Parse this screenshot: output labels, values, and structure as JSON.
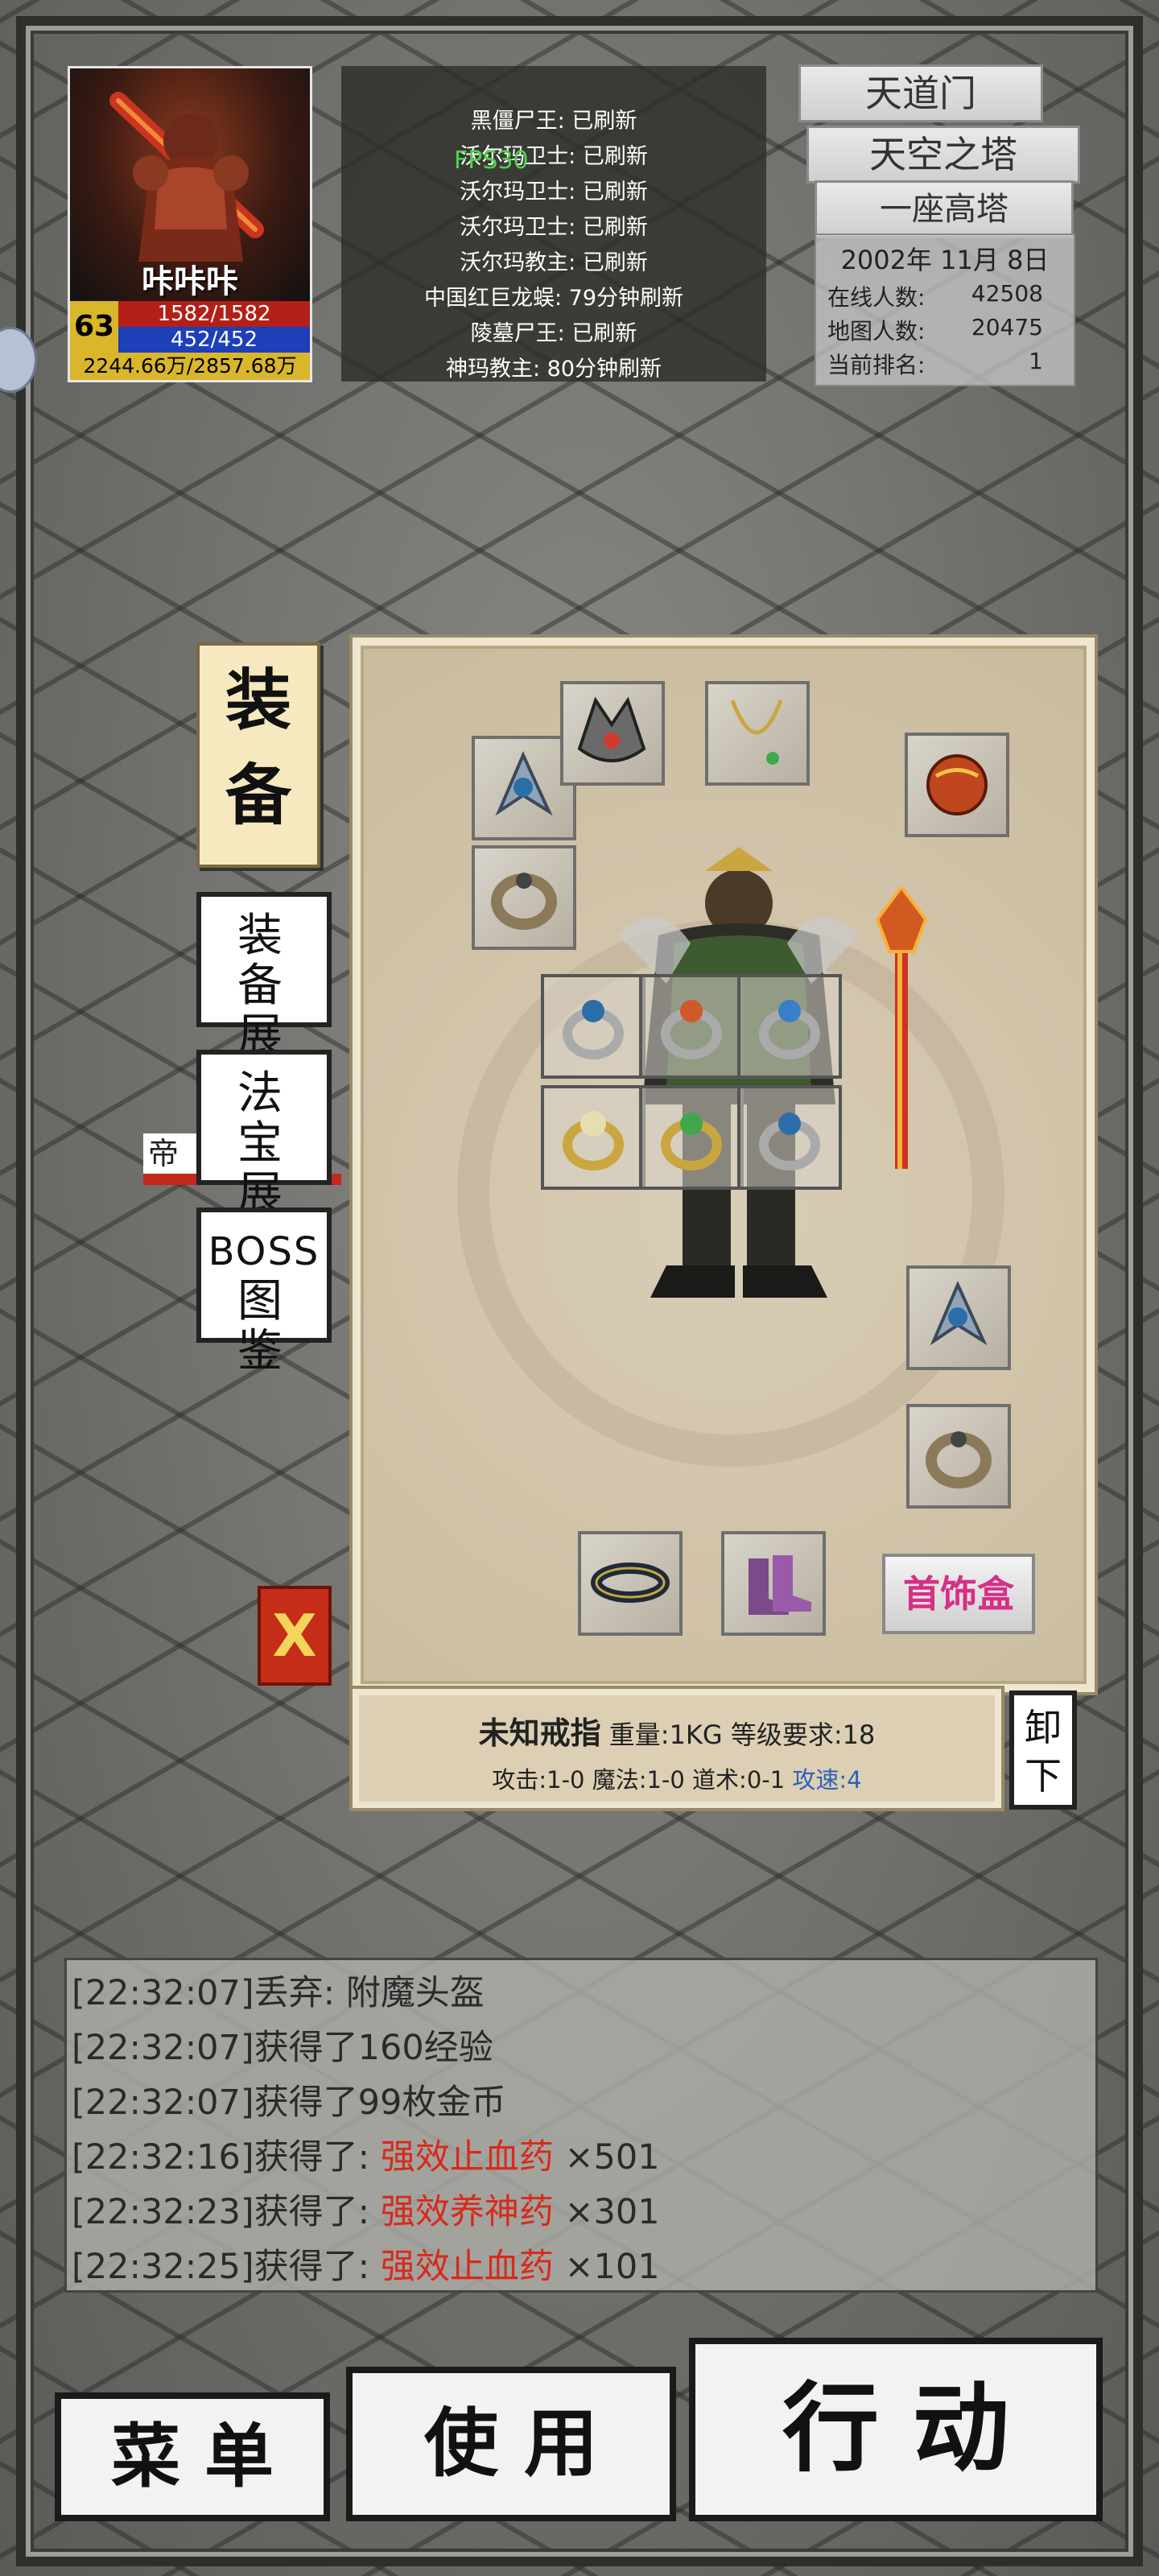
{
  "player": {
    "name": "咔咔咔",
    "level": "63",
    "hp": "1582/1582",
    "mp": "452/452",
    "exp": "2244.66万/2857.68万"
  },
  "boss_status": [
    "黑僵尸王: 已刷新",
    "沃尔玛卫士: 已刷新",
    "沃尔玛卫士: 已刷新",
    "沃尔玛卫士: 已刷新",
    "沃尔玛教主: 已刷新",
    "中国红巨龙蜈: 79分钟刷新",
    "陵墓尸王: 已刷新",
    "神玛教主: 80分钟刷新"
  ],
  "fps": "FPS30",
  "server": {
    "sect": "天道门",
    "area": "天空之塔",
    "map": "一座高塔",
    "date": "2002年 11月 8日",
    "online_label": "在线人数:",
    "online_value": "42508",
    "map_label": "地图人数:",
    "map_value": "20475",
    "rank_label": "当前排名:",
    "rank_value": "1"
  },
  "side_menu": {
    "equip": [
      "装",
      "备"
    ],
    "equip_rack": [
      "装 备",
      "展 架"
    ],
    "treasure_rack": [
      "法 宝",
      "展 架"
    ],
    "boss_book": [
      "BOSS",
      "图 鉴"
    ],
    "close": "X"
  },
  "npc": {
    "name": "帝"
  },
  "equipment": {
    "jewelry_box": "首饰盒",
    "item_name": "未知戒指",
    "item_weight": "重量:1KG",
    "item_level_req": "等级要求:18",
    "item_stats": "攻击:1-0 魔法:1-0 道术:0-1",
    "item_speed": "攻速:4",
    "unequip": [
      "卸",
      "下"
    ]
  },
  "log": [
    {
      "time": "[22:32:07]",
      "text": "丢弃: 附魔头盔",
      "item": "",
      "qty": ""
    },
    {
      "time": "[22:32:07]",
      "text": "获得了160经验",
      "item": "",
      "qty": ""
    },
    {
      "time": "[22:32:07]",
      "text": "获得了99枚金币",
      "item": "",
      "qty": ""
    },
    {
      "time": "[22:32:16]",
      "text": "获得了: ",
      "item": "强效止血药",
      "qty": " ×501"
    },
    {
      "time": "[22:32:23]",
      "text": "获得了: ",
      "item": "强效养神药",
      "qty": " ×301"
    },
    {
      "time": "[22:32:25]",
      "text": "获得了: ",
      "item": "强效止血药",
      "qty": " ×101"
    }
  ],
  "bottom": {
    "menu": "菜 单",
    "use": "使 用",
    "action": "行 动"
  },
  "colors": {
    "item_highlight": "#d72a1c",
    "speed": "#2a63b8",
    "jewelry": "#d62f86",
    "exp_bar": "#d9b62a"
  }
}
